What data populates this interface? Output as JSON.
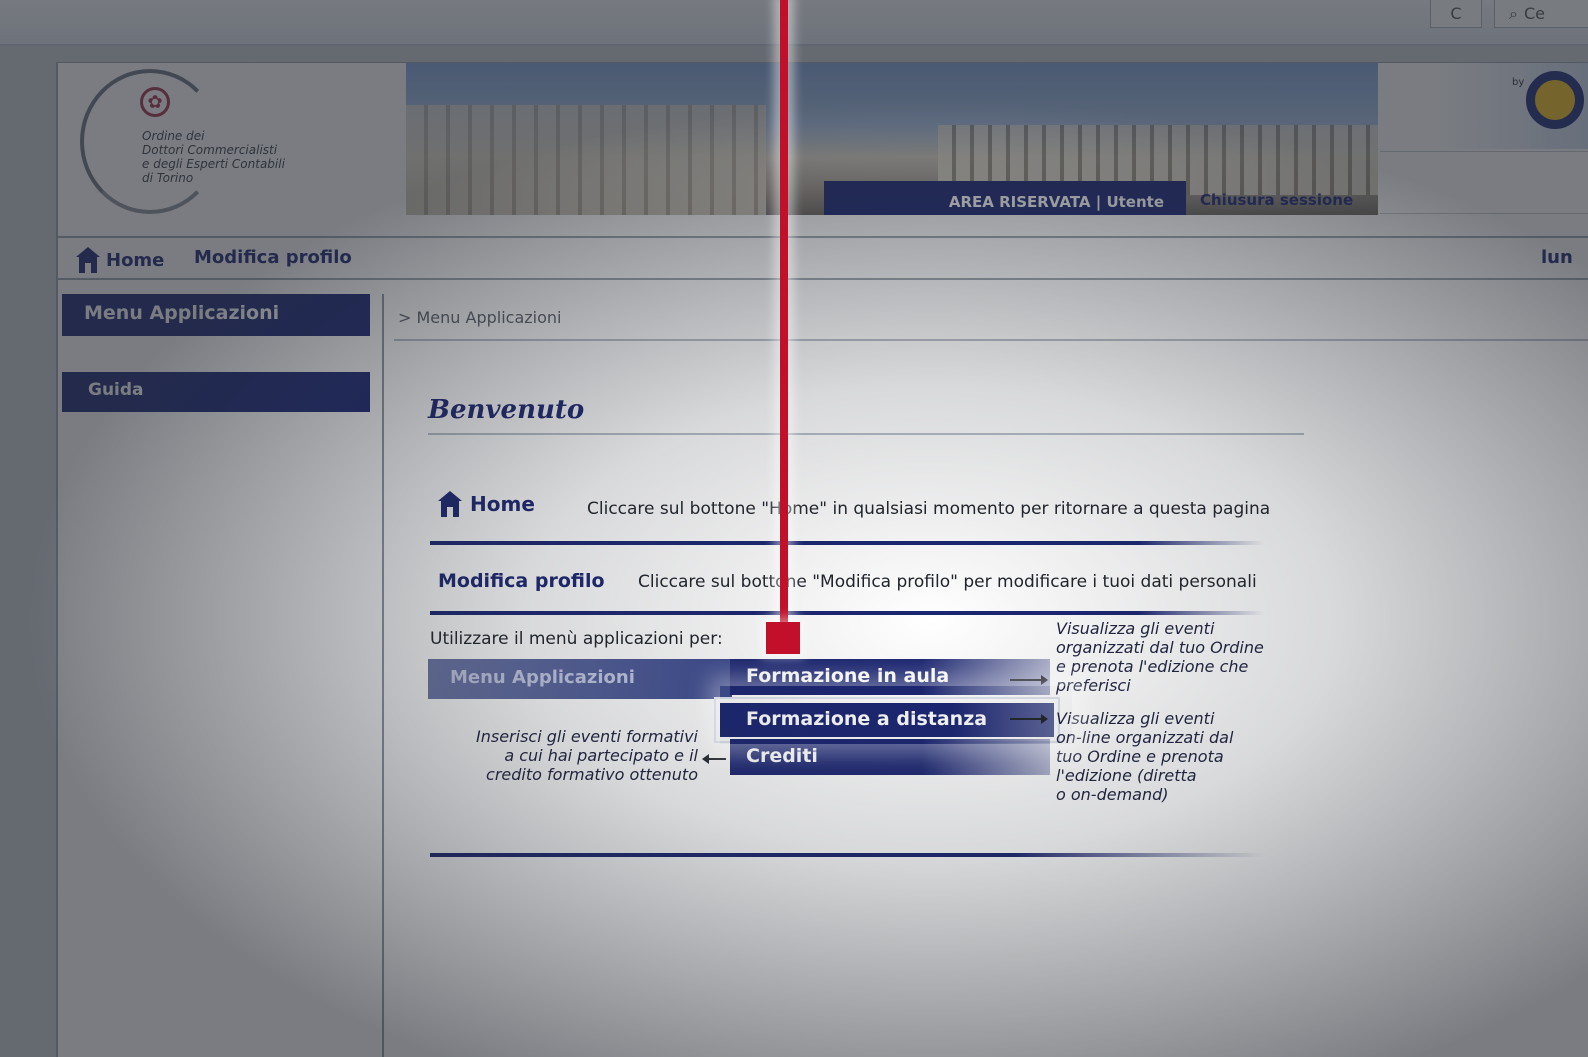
{
  "browser": {
    "refresh_glyph": "C",
    "search_text": "Ce"
  },
  "header": {
    "logo_lines": [
      "Ordine dei",
      "Dottori Commercialisti",
      "e degli Esperti Contabili",
      "di Torino"
    ],
    "partner_by": "by",
    "area_riservata": "AREA RISERVATA | Utente",
    "chiusura": "Chiusura sessione"
  },
  "topnav": {
    "home": "Home",
    "modifica_profilo": "Modifica profilo",
    "date_partial": "lun"
  },
  "sidebar": {
    "header": "Menu Applicazioni",
    "guida": "Guida"
  },
  "main": {
    "breadcrumb": "> Menu Applicazioni",
    "welcome": "Benvenuto",
    "home_label": "Home",
    "home_desc": "Cliccare sul bottone \"Home\" in qualsiasi momento per ritornare a questa pagina",
    "profilo_label": "Modifica profilo",
    "profilo_desc": "Cliccare sul bottone \"Modifica profilo\" per modificare i tuoi dati personali",
    "usare": "Utilizzare il menù applicazioni per:",
    "menu_label": "Menu Applicazioni",
    "btn_aula": "Formazione in aula",
    "btn_distanza": "Formazione a distanza",
    "btn_crediti": "Crediti",
    "note_aula": [
      "Visualizza gli eventi",
      "organizzati dal tuo Ordine",
      "e prenota l'edizione che",
      "preferisci"
    ],
    "note_distanza": [
      "Visualizza gli eventi",
      "on-line organizzati dal",
      "tuo Ordine e prenota",
      "l'edizione (diretta",
      "o on-demand)"
    ],
    "note_crediti": [
      "Inserisci gli eventi formativi",
      "a cui hai partecipato e il",
      "credito formativo ottenuto"
    ]
  },
  "colors": {
    "brand_navy": "#1b2672",
    "pointer_red": "#c3102a",
    "logo_red": "#a1324a"
  },
  "icons": [
    "refresh-icon",
    "search-icon",
    "home-icon",
    "logo-star-icon",
    "pointer-marker"
  ]
}
